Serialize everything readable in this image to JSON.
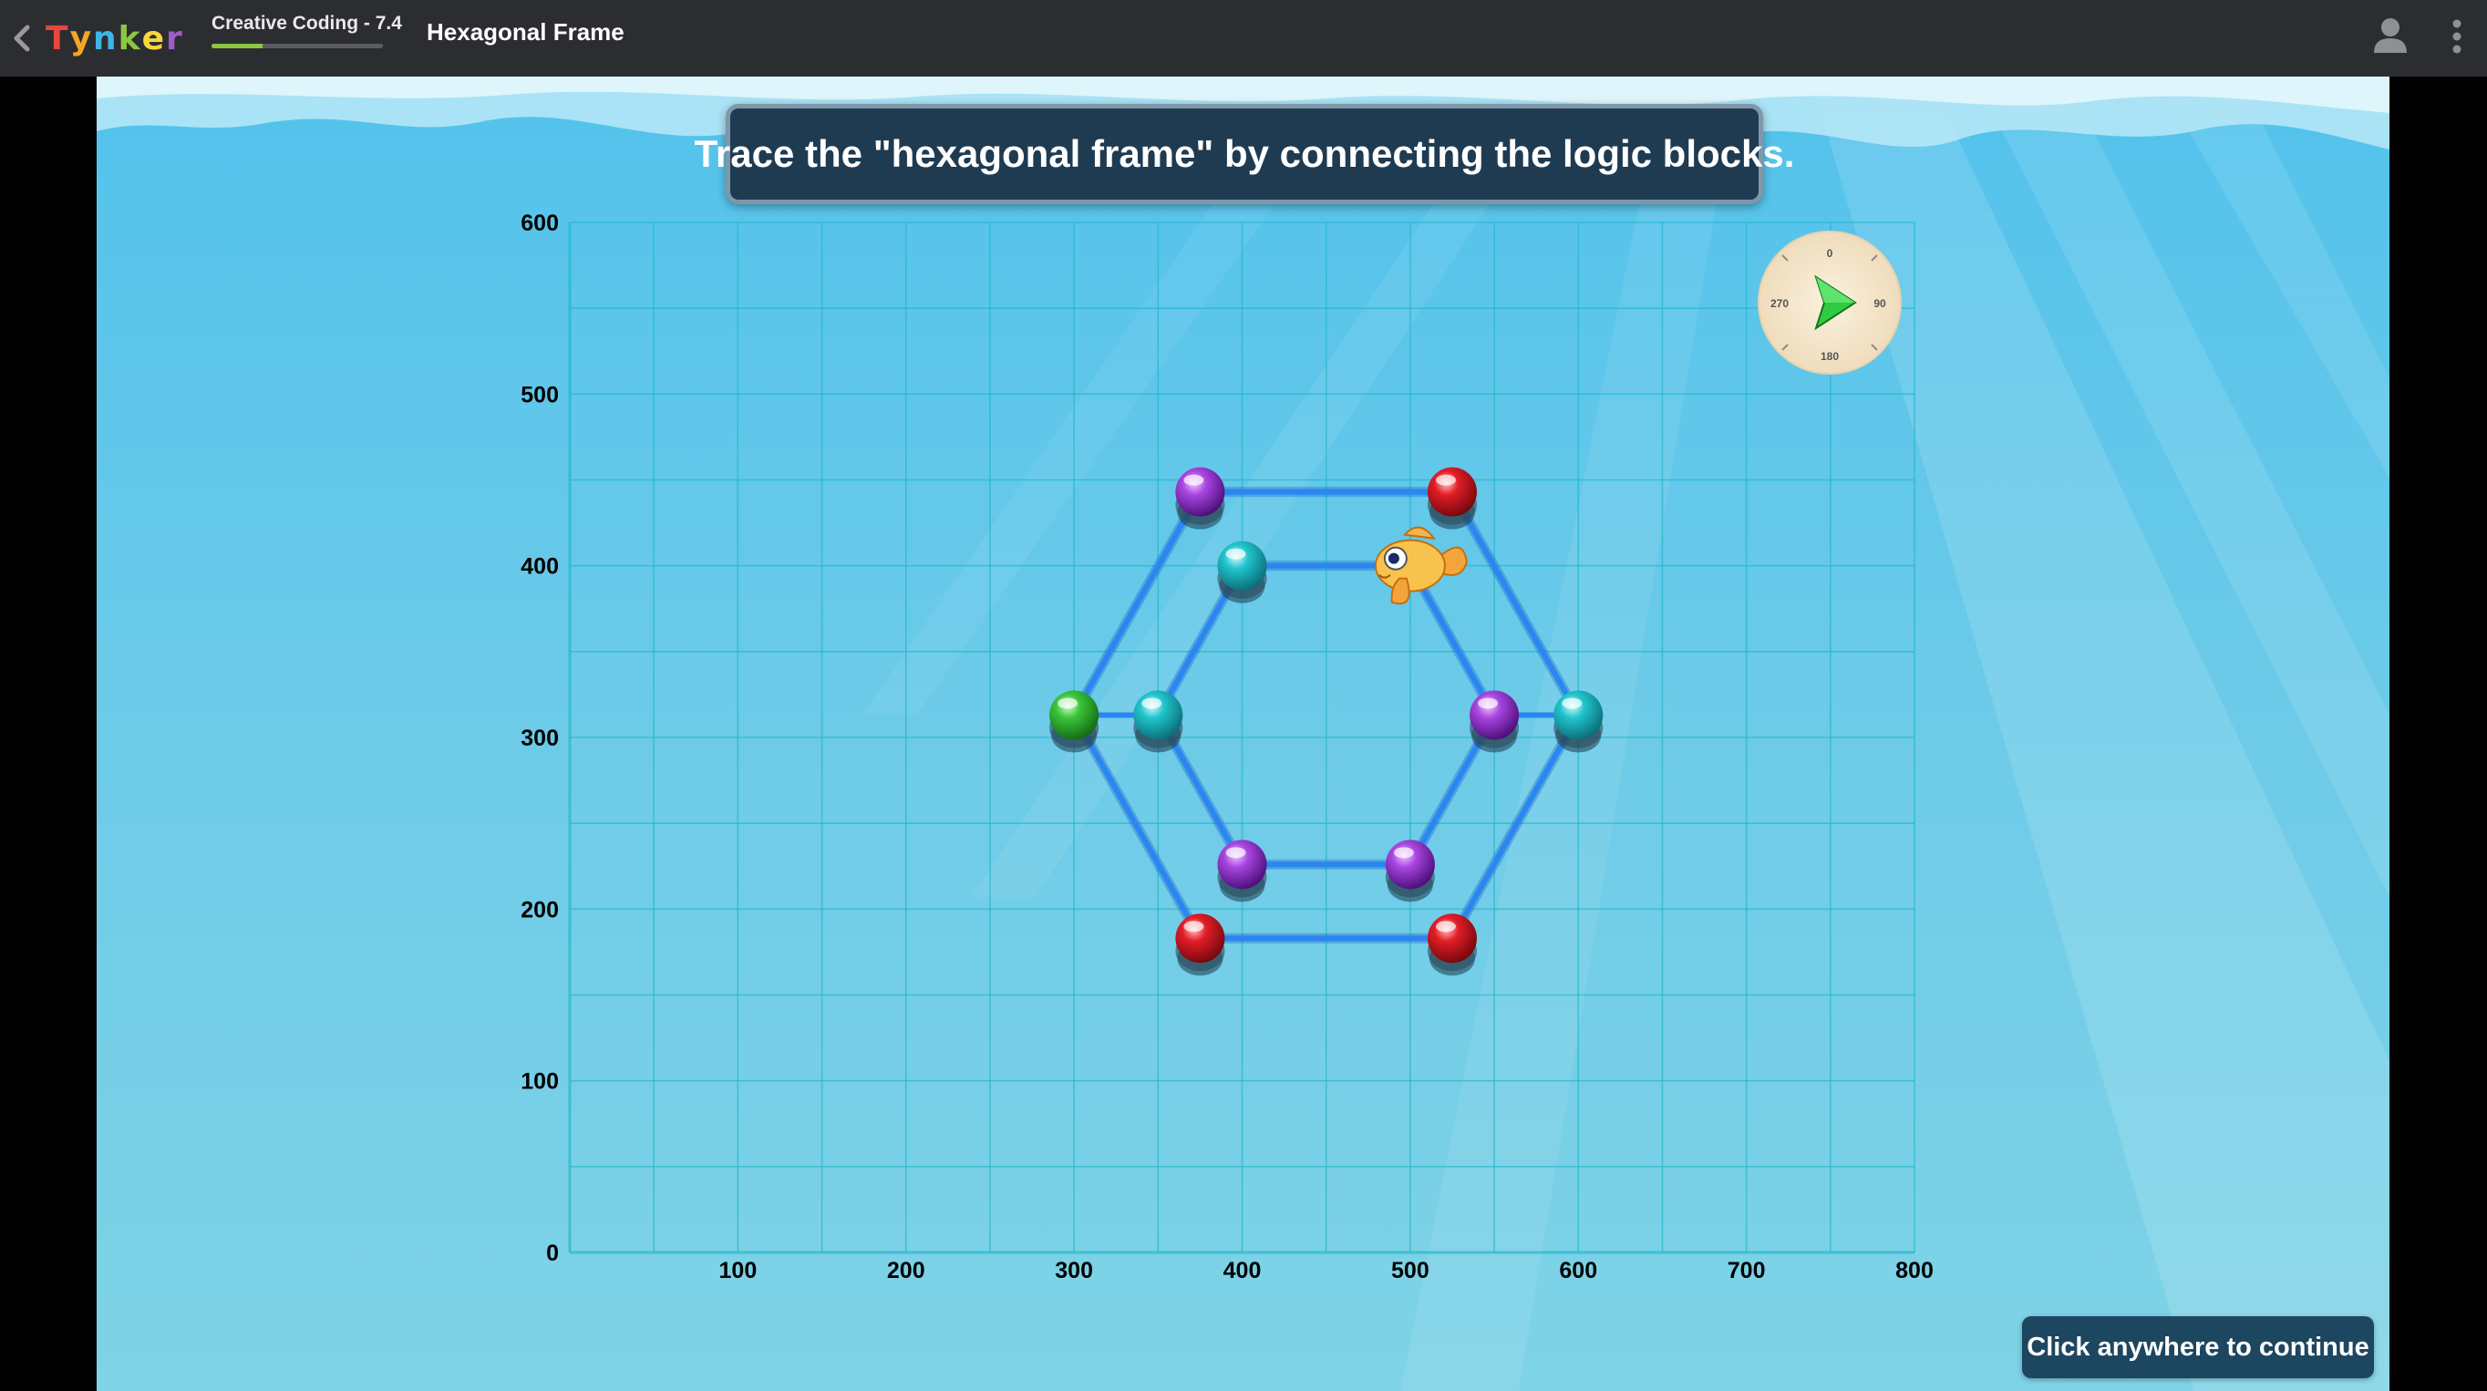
{
  "header": {
    "logo_letters": [
      "T",
      "y",
      "n",
      "k",
      "e",
      "r"
    ],
    "logo_colors": [
      "#e8473a",
      "#f5a623",
      "#3fb6e8",
      "#8dc63f",
      "#f7d63c",
      "#a05cc8"
    ],
    "course_label": "Creative Coding - 7.4",
    "course_progress": 0.3,
    "lesson_title": "Hexagonal Frame",
    "back_icon": "chevron-left-icon",
    "user_icon": "user-icon",
    "menu_icon": "vertical-dots-icon"
  },
  "instruction": "Trace the \"hexagonal frame\" by connecting the logic blocks.",
  "continue_label": "Click anywhere to continue",
  "compass": {
    "labels": [
      "0",
      "90",
      "180",
      "270"
    ],
    "heading": 90
  },
  "colors": {
    "line": "#2a86f0",
    "purple": "#9b30d9",
    "red": "#e0202a",
    "cyan": "#22c5cf",
    "green": "#38c23a",
    "arrow": "#2ecc40"
  },
  "chart_data": {
    "type": "scatter",
    "x_ticks": [
      100,
      200,
      300,
      400,
      500,
      600,
      700,
      800
    ],
    "y_ticks": [
      0,
      100,
      200,
      300,
      400,
      500,
      600
    ],
    "xlim": [
      0,
      800
    ],
    "ylim": [
      0,
      600
    ],
    "grid": true,
    "outer_hexagon": [
      [
        375,
        443
      ],
      [
        525,
        443
      ],
      [
        600,
        313
      ],
      [
        525,
        183
      ],
      [
        375,
        183
      ],
      [
        300,
        313
      ]
    ],
    "inner_hexagon": [
      [
        400,
        400
      ],
      [
        500,
        400
      ],
      [
        550,
        313
      ],
      [
        500,
        226
      ],
      [
        400,
        226
      ],
      [
        350,
        313
      ]
    ],
    "orbs": [
      {
        "x": 375,
        "y": 443,
        "color": "purple"
      },
      {
        "x": 525,
        "y": 443,
        "color": "red"
      },
      {
        "x": 400,
        "y": 400,
        "color": "cyan"
      },
      {
        "x": 300,
        "y": 313,
        "color": "green"
      },
      {
        "x": 350,
        "y": 313,
        "color": "cyan"
      },
      {
        "x": 550,
        "y": 313,
        "color": "purple"
      },
      {
        "x": 600,
        "y": 313,
        "color": "cyan"
      },
      {
        "x": 400,
        "y": 226,
        "color": "purple"
      },
      {
        "x": 500,
        "y": 226,
        "color": "purple"
      },
      {
        "x": 375,
        "y": 183,
        "color": "red"
      },
      {
        "x": 525,
        "y": 183,
        "color": "red"
      }
    ],
    "fish": {
      "x": 500,
      "y": 400
    }
  }
}
